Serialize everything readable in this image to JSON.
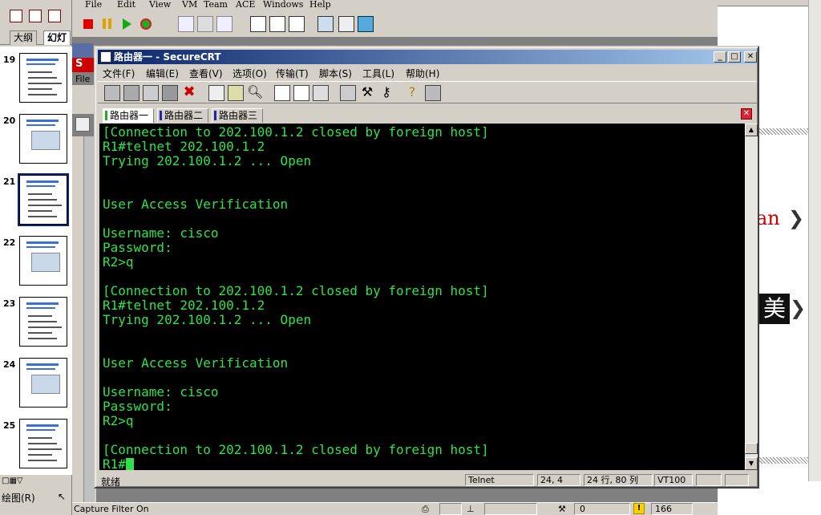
{
  "ppt": {
    "tabs": [
      "大纲",
      "幻灯"
    ],
    "slides": [
      {
        "num": "19",
        "selected": false
      },
      {
        "num": "20",
        "selected": false
      },
      {
        "num": "21",
        "selected": true
      },
      {
        "num": "22",
        "selected": false
      },
      {
        "num": "23",
        "selected": false
      },
      {
        "num": "24",
        "selected": false
      },
      {
        "num": "25",
        "selected": false
      }
    ],
    "draw_label": "绘图(R)"
  },
  "vm": {
    "menu": [
      "File",
      "Edit",
      "View",
      "VM",
      "Team",
      "ACE",
      "Windows",
      "Help"
    ],
    "inner_file_label": "File",
    "status_left": "Capture Filter On",
    "status_num1": "0",
    "status_num2": "166"
  },
  "right": {
    "text_fragment": "an",
    "chinese_char": "美"
  },
  "crt": {
    "title": "路由器一 - SecureCRT",
    "menu": [
      "文件(F)",
      "编辑(E)",
      "查看(V)",
      "选项(O)",
      "传输(T)",
      "脚本(S)",
      "工具(L)",
      "帮助(H)"
    ],
    "tabs": [
      "路由器一",
      "路由器二",
      "路由器三"
    ],
    "terminal_lines": [
      "[Connection to 202.100.1.2 closed by foreign host]",
      "R1#telnet 202.100.1.2",
      "Trying 202.100.1.2 ... Open",
      "",
      "",
      "User Access Verification",
      "",
      "Username: cisco",
      "Password:",
      "R2>q",
      "",
      "[Connection to 202.100.1.2 closed by foreign host]",
      "R1#telnet 202.100.1.2",
      "Trying 202.100.1.2 ... Open",
      "",
      "",
      "User Access Verification",
      "",
      "Username: cisco",
      "Password:",
      "R2>q",
      "",
      "[Connection to 202.100.1.2 closed by foreign host]"
    ],
    "prompt": "R1#",
    "status": {
      "ready": "就绪",
      "protocol": "Telnet",
      "position": "24,   4",
      "rows_cols": "24 行, 80 列",
      "emulation": "VT100"
    }
  }
}
